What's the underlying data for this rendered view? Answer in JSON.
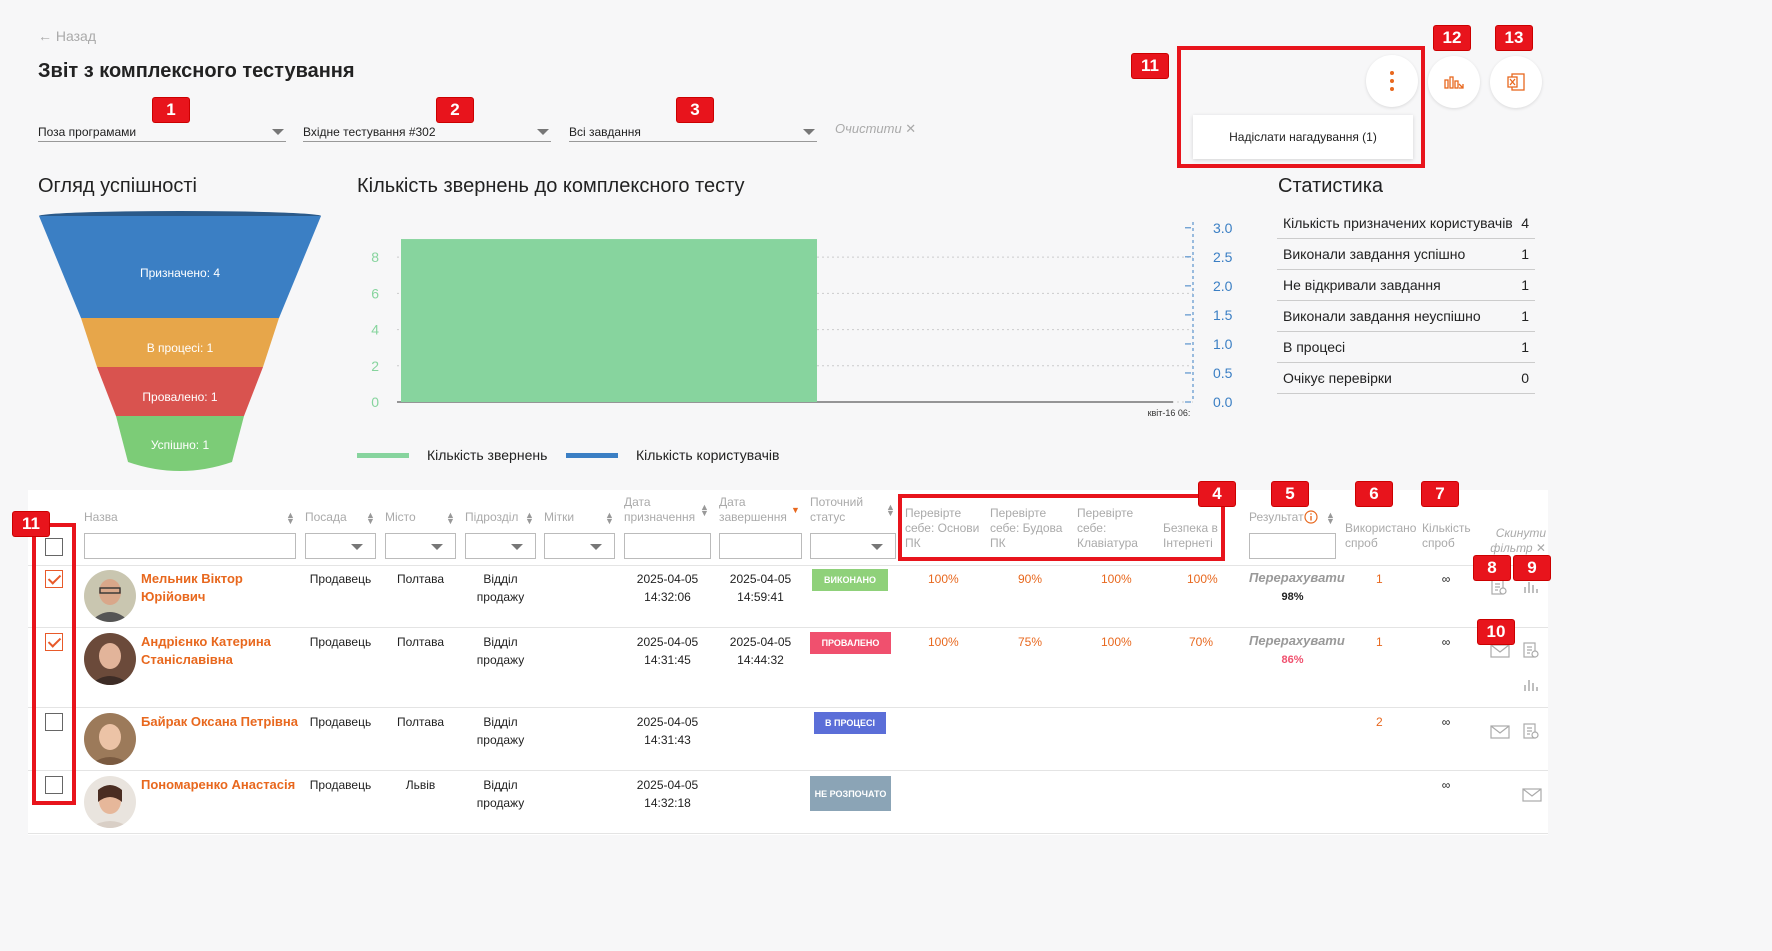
{
  "header": {
    "back_label": "← Назад",
    "title": "Звіт з комплексного тестування",
    "clear_label": "Очистити ✕"
  },
  "filters": {
    "program": "Поза програмами",
    "testing": "Вхідне тестування #302",
    "tasks": "Всі завдання"
  },
  "actions": {
    "send_reminder": "Надіслати нагадування (1)"
  },
  "badges": [
    "1",
    "2",
    "3",
    "4",
    "5",
    "6",
    "7",
    "8",
    "9",
    "10",
    "11",
    "11",
    "12",
    "13"
  ],
  "funnel": {
    "title": "Огляд успішності",
    "stages": [
      {
        "label": "Призначено: 4",
        "color": "#3b7fc4"
      },
      {
        "label": "В процесі: 1",
        "color": "#e7a64a"
      },
      {
        "label": "Провалено: 1",
        "color": "#d9534f"
      },
      {
        "label": "Успішно: 1",
        "color": "#7ccc77"
      }
    ]
  },
  "chart_data": {
    "type": "bar",
    "title": "Кількість звернень до комплексного тесту",
    "categories": [
      "квіт-16 06:"
    ],
    "series": [
      {
        "name": "Кількість звернень",
        "values": [
          9
        ],
        "color": "#87d49e",
        "axis": "left"
      },
      {
        "name": "Кількість користувачів",
        "values": [],
        "color": "#3b7fc4",
        "axis": "right"
      }
    ],
    "y_left_ticks": [
      "0",
      "2",
      "4",
      "6",
      "8"
    ],
    "y_right_ticks": [
      "0.0",
      "0.5",
      "1.0",
      "1.5",
      "2.0",
      "2.5",
      "3.0"
    ],
    "ylim_left": [
      0,
      9.5
    ],
    "ylim_right": [
      0,
      3.1
    ]
  },
  "stats": {
    "title": "Статистика",
    "rows": [
      {
        "label": "Кількість призначених користувачів",
        "value": "4"
      },
      {
        "label": "Виконали завдання успішно",
        "value": "1"
      },
      {
        "label": "Не відкривали завдання",
        "value": "1"
      },
      {
        "label": "Виконали завдання неуспішно",
        "value": "1"
      },
      {
        "label": "В процесі",
        "value": "1"
      },
      {
        "label": "Очікує перевірки",
        "value": "0"
      }
    ]
  },
  "table": {
    "headers": {
      "name": "Назва",
      "position": "Посада",
      "city": "Місто",
      "department": "Підрозділ",
      "tags": "Мітки",
      "assigned_date": "Дата призначення",
      "completed_date": "Дата завершення",
      "status": "Поточний статус",
      "test1": "Перевірте себе: Основи ПК",
      "test2": "Перевірте себе: Будова ПК",
      "test3": "Перевірте себе: Клавіатура",
      "test4": "Безпека в Інтернеті",
      "result": "Результат",
      "attempts_used": "Використано спроб",
      "attempts_total": "Кількість спроб",
      "reset_filter": "Скинути фільтр ✕"
    },
    "rows": [
      {
        "name": "Мельник Віктор Юрійович",
        "position": "Продавець",
        "city": "Полтава",
        "department": "Відділ продажу",
        "assigned": "2025-04-05 14:32:06",
        "completed": "2025-04-05 14:59:41",
        "status": "ВИКОНАНО",
        "status_color": "#8fd17a",
        "scores": [
          "100%",
          "90%",
          "100%",
          "100%"
        ],
        "recalc": "Перерахувати",
        "result": "98%",
        "result_color": "#333333",
        "used": "1",
        "total": "∞",
        "checked": true
      },
      {
        "name": "Андрієнко Катерина Станіславівна",
        "position": "Продавець",
        "city": "Полтава",
        "department": "Відділ продажу",
        "assigned": "2025-04-05 14:31:45",
        "completed": "2025-04-05 14:44:32",
        "status": "ПРОВАЛЕНО",
        "status_color": "#f0506e",
        "scores": [
          "100%",
          "75%",
          "100%",
          "70%"
        ],
        "recalc": "Перерахувати",
        "result": "86%",
        "result_color": "#f0506e",
        "used": "1",
        "total": "∞",
        "checked": true
      },
      {
        "name": "Байрак Оксана Петрівна",
        "position": "Продавець",
        "city": "Полтава",
        "department": "Відділ продажу",
        "assigned": "2025-04-05 14:31:43",
        "completed": "",
        "status": "В ПРОЦЕСІ",
        "status_color": "#5b6ed8",
        "scores": [
          "",
          "",
          "",
          ""
        ],
        "recalc": "",
        "result": "",
        "result_color": "#333333",
        "used": "2",
        "total": "∞",
        "checked": false
      },
      {
        "name": "Пономаренко Анастасія",
        "position": "Продавець",
        "city": "Львів",
        "department": "Відділ продажу",
        "assigned": "2025-04-05 14:32:18",
        "completed": "",
        "status": "НЕ РОЗПОЧАТО",
        "status_color": "#8ba4b6",
        "scores": [
          "",
          "",
          "",
          ""
        ],
        "recalc": "",
        "result": "",
        "result_color": "#333333",
        "used": "",
        "total": "∞",
        "checked": false
      }
    ]
  }
}
